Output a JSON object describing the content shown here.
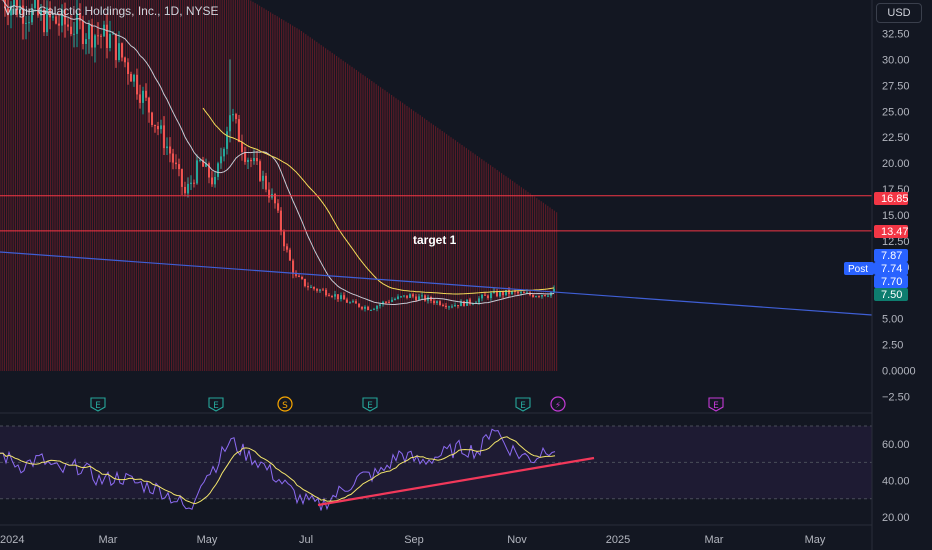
{
  "header": {
    "title": "Virgin Galactic Holdings, Inc., 1D, NYSE",
    "currency": "USD"
  },
  "colors": {
    "background": "#131722",
    "up": "#26a69a",
    "down": "#ef5350",
    "volume_bar": "#5d1b26",
    "ma_fast": "#c6c9d3",
    "ma_slow": "#f3dc5a",
    "trendline": "#3f5fd6",
    "level_line": "#f23645",
    "rsi_line": "#8c6bf2",
    "rsi_ma": "#f3e56b",
    "rsi_trend": "#f2385a",
    "rsi_band": "#1e1b33",
    "badge_blue": "#2962ff",
    "badge_red": "#f23645",
    "badge_teal": "#0e7d6f"
  },
  "chart_data": [
    {
      "type": "candlestick",
      "pane": "price",
      "title": "Virgin Galactic Holdings, Inc., 1D, NYSE",
      "x_ticks": [
        "2024",
        "Mar",
        "May",
        "Jul",
        "Sep",
        "Nov",
        "2025",
        "Mar",
        "May"
      ],
      "y_ticks": [
        "32.50",
        "30.00",
        "27.50",
        "25.00",
        "22.50",
        "20.00",
        "17.50",
        "15.00",
        "12.50",
        "10.00",
        "7.50",
        "5.00",
        "2.50",
        "0.0000",
        "−2.50"
      ],
      "ylim": [
        -3.8,
        34.3
      ],
      "close_series_approx": {
        "x": [
          "2024-01",
          "2024-02",
          "2024-03",
          "2024-04",
          "2024-05",
          "2024-06",
          "2024-07",
          "2024-08",
          "2024-09",
          "2024-10",
          "2024-11"
        ],
        "values": [
          36.0,
          33.0,
          26.0,
          19.0,
          21.0,
          16.0,
          8.0,
          6.0,
          6.5,
          7.5,
          7.5
        ]
      },
      "horizontal_levels": [
        16.85,
        13.47
      ],
      "annotations": [
        "target 1"
      ],
      "price_badges": [
        {
          "label": "",
          "value": "16.85",
          "color": "red"
        },
        {
          "label": "",
          "value": "13.47",
          "color": "red"
        },
        {
          "label": "",
          "value": "7.87",
          "color": "blue"
        },
        {
          "label": "Post",
          "value": "7.74",
          "color": "blue"
        },
        {
          "label": "",
          "value": "7.70",
          "color": "blue"
        },
        {
          "label": "",
          "value": "7.50",
          "color": "teal"
        }
      ],
      "event_markers": [
        "E",
        "E",
        "S",
        "E",
        "E",
        "⚡",
        "E"
      ]
    },
    {
      "type": "line",
      "pane": "rsi",
      "y_ticks": [
        "60.00",
        "40.00",
        "20.00"
      ],
      "ylim": [
        16,
        67
      ],
      "band": [
        30,
        70
      ],
      "midline": 50,
      "series_approx": {
        "x": [
          "2024-01",
          "2024-02",
          "2024-03",
          "2024-04",
          "2024-05",
          "2024-06",
          "2024-07",
          "2024-08",
          "2024-09",
          "2024-10",
          "2024-11"
        ],
        "values": [
          52,
          45,
          40,
          35,
          48,
          38,
          28,
          40,
          44,
          62,
          54
        ]
      }
    }
  ]
}
